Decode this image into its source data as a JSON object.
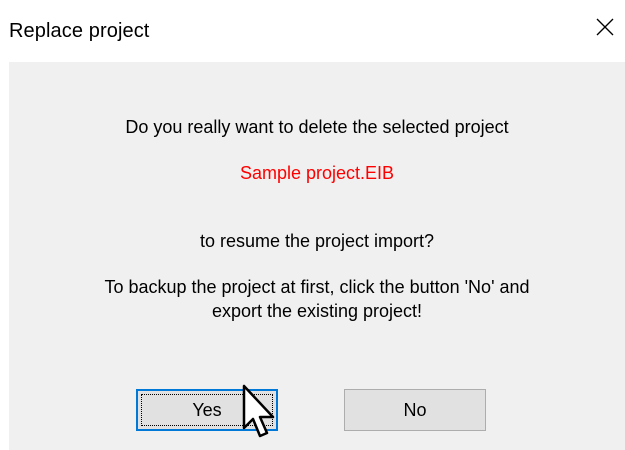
{
  "dialog": {
    "title": "Replace project",
    "close_icon": "close-icon"
  },
  "message": {
    "line1": "Do you really want to delete the selected project",
    "project_name": "Sample project.EIB",
    "line2": "to resume the project import?",
    "line3": "To backup the project at first, click the button 'No' and",
    "line4": "export the existing project!"
  },
  "buttons": {
    "yes_label": "Yes",
    "no_label": "No"
  },
  "colors": {
    "project_name": "#ff0000",
    "focus_border": "#0078d7",
    "button_face": "#e1e1e1",
    "dialog_bg": "#f0f0f0"
  },
  "cursor_icon": "arrow-pointer-icon"
}
